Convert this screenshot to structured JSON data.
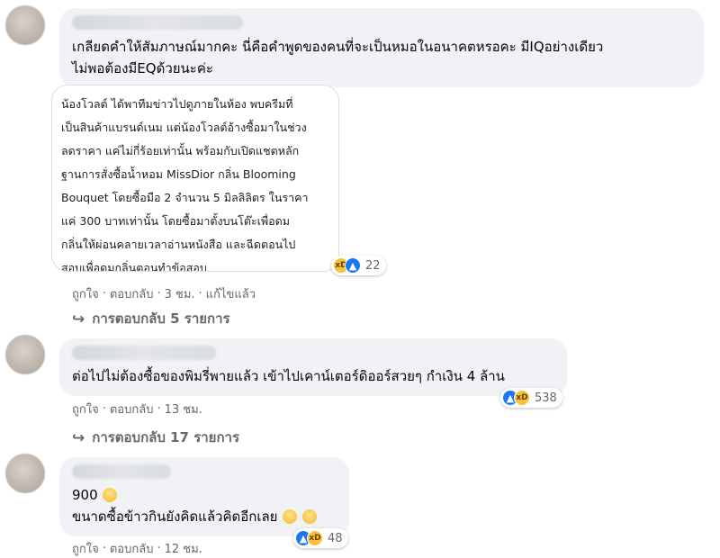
{
  "comments": [
    {
      "text_lines": [
        "เกลียดคำให้สัมภาษณ์มากคะ นี่คือคำพูดของคนที่จะเป็นหมอในอนาคตหรอคะ มีIQอย่างเดียว",
        "ไม่พอต้องมีEQด้วยนะค่ะ"
      ],
      "image_text_lines": [
        "น้องโวลต์ ได้พาทีมข่าวไปดูภายในห้อง พบครีมที่",
        "เป็นสินค้าแบรนด์เนม แต่น้องโวลต์อ้างซื้อมาในช่วง",
        "ลดราคา แค่ไม่กี่ร้อยเท่านั้น พร้อมกับเปิดแชตหลัก",
        "ฐานการสั่งซื้อน้ำหอม MissDior กลิ่น Blooming",
        "Bouquet โดยซื้อมือ 2 จำนวน 5 มิลลิลิตร ในราคา",
        "แค่ 300 บาทเท่านั้น โดยซื้อมาตั้งบนโต๊ะเพื่อดม",
        "กลิ่นให้ผ่อนคลายเวลาอ่านหนังสือ และฉีดตอนไป",
        "สอบเพื่อดมกลิ่นตอนทำข้อสอบ"
      ],
      "reaction_count": "22",
      "like_label": "ถูกใจ",
      "reply_label": "ตอบกลับ",
      "time": "3 ชม.",
      "edited": "แก้ไขแล้ว",
      "replies_label": "การตอบกลับ 5 รายการ"
    },
    {
      "text_lines": [
        "ต่อไปไม่ต้องซื้อของพิมรี่พายแล้ว เข้าไปเคาน์เตอร์ดิออร์สวยๆ กำเงิน 4 ล้าน"
      ],
      "reaction_count": "538",
      "like_label": "ถูกใจ",
      "reply_label": "ตอบกลับ",
      "time": "13 ชม.",
      "replies_label": "การตอบกลับ 17 รายการ"
    },
    {
      "text_lines": [
        "900",
        "ขนาดซื้อข้าวกินยังคิดแล้วคิดอีกเลย"
      ],
      "reaction_count": "48",
      "like_label": "ถูกใจ",
      "reply_label": "ตอบกลับ",
      "time": "12 ชม."
    }
  ],
  "icons": {
    "reply_arrow": "↪",
    "like": "👍",
    "haha": "😆"
  },
  "colors": {
    "bubble": "#f0f2f5",
    "meta_text": "#65676b",
    "like_blue": "#1877f2",
    "haha_yellow": "#f7c23a"
  }
}
